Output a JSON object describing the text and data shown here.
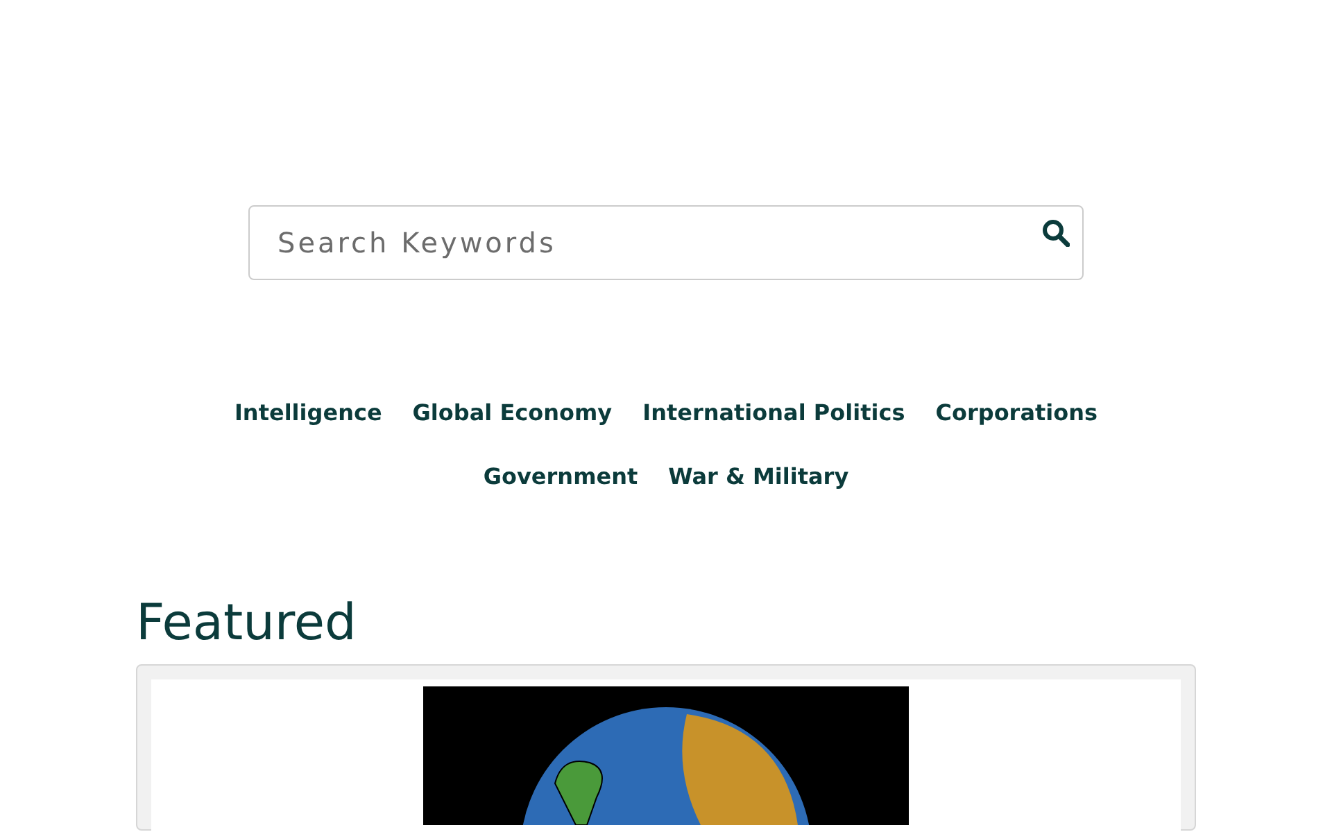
{
  "search": {
    "placeholder": "Search Keywords"
  },
  "categories": [
    "Intelligence",
    "Global Economy",
    "International Politics",
    "Corporations",
    "Government",
    "War & Military"
  ],
  "featured": {
    "title": "Featured"
  }
}
